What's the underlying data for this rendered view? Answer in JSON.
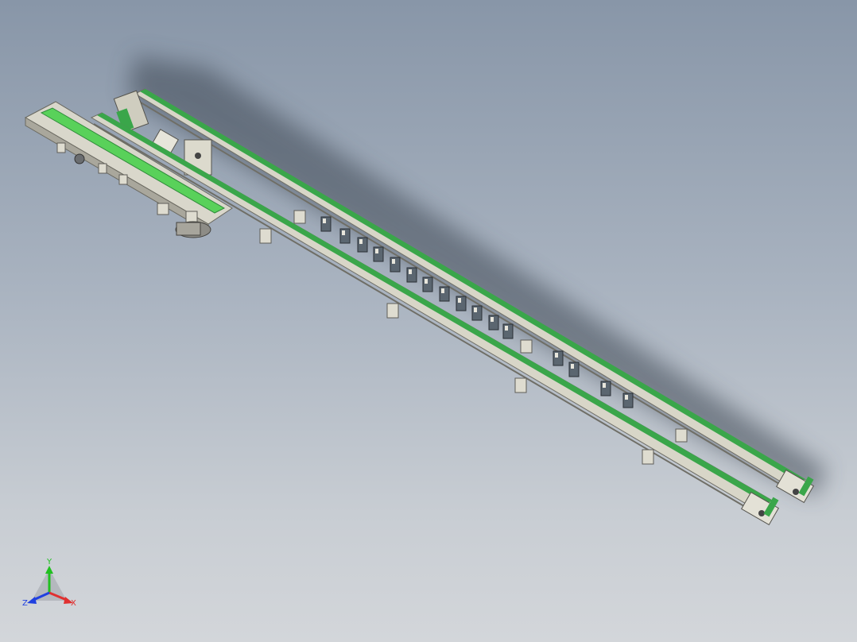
{
  "viewport": {
    "background_top": "#8896a8",
    "background_bottom": "#d3d6da"
  },
  "model": {
    "belt_color": "#3aa64a",
    "belt_highlight": "#59d15a",
    "frame_color": "#d8d6c8",
    "frame_dark": "#7d7c72",
    "block_color": "#5b6670"
  },
  "triad": {
    "x_label": "X",
    "y_label": "Y",
    "z_label": "Z",
    "x_color": "#e03030",
    "y_color": "#20c020",
    "z_color": "#2040e0"
  }
}
